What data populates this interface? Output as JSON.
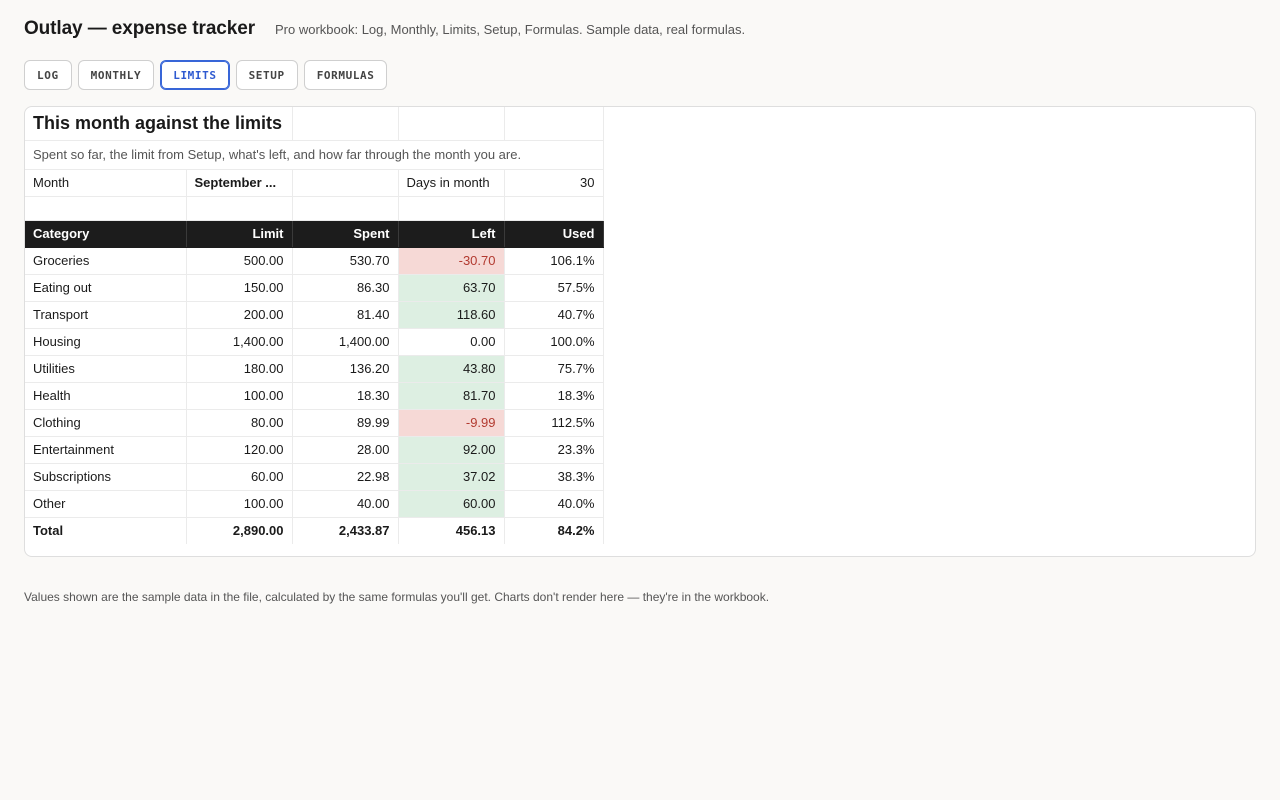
{
  "app": {
    "title": "Outlay — expense tracker",
    "subtitle": "Pro workbook: Log, Monthly, Limits, Setup, Formulas. Sample data, real formulas."
  },
  "tabs": [
    {
      "label": "LOG",
      "active": false
    },
    {
      "label": "MONTHLY",
      "active": false
    },
    {
      "label": "LIMITS",
      "active": true
    },
    {
      "label": "SETUP",
      "active": false
    },
    {
      "label": "FORMULAS",
      "active": false
    }
  ],
  "sheet": {
    "title": "This month against the limits",
    "description": "Spent so far, the limit from Setup, what's left, and how far through the month you are.",
    "month_label": "Month",
    "month_value": "September ...",
    "days_label": "Days in month",
    "days_value": "30",
    "headers": [
      "Category",
      "Limit",
      "Spent",
      "Left",
      "Used"
    ],
    "rows": [
      {
        "category": "Groceries",
        "limit": "500.00",
        "spent": "530.70",
        "left": "-30.70",
        "used": "106.1%",
        "status": "over"
      },
      {
        "category": "Eating out",
        "limit": "150.00",
        "spent": "86.30",
        "left": "63.70",
        "used": "57.5%",
        "status": "under"
      },
      {
        "category": "Transport",
        "limit": "200.00",
        "spent": "81.40",
        "left": "118.60",
        "used": "40.7%",
        "status": "under"
      },
      {
        "category": "Housing",
        "limit": "1,400.00",
        "spent": "1,400.00",
        "left": "0.00",
        "used": "100.0%",
        "status": "even"
      },
      {
        "category": "Utilities",
        "limit": "180.00",
        "spent": "136.20",
        "left": "43.80",
        "used": "75.7%",
        "status": "under"
      },
      {
        "category": "Health",
        "limit": "100.00",
        "spent": "18.30",
        "left": "81.70",
        "used": "18.3%",
        "status": "under"
      },
      {
        "category": "Clothing",
        "limit": "80.00",
        "spent": "89.99",
        "left": "-9.99",
        "used": "112.5%",
        "status": "over"
      },
      {
        "category": "Entertainment",
        "limit": "120.00",
        "spent": "28.00",
        "left": "92.00",
        "used": "23.3%",
        "status": "under"
      },
      {
        "category": "Subscriptions",
        "limit": "60.00",
        "spent": "22.98",
        "left": "37.02",
        "used": "38.3%",
        "status": "under"
      },
      {
        "category": "Other",
        "limit": "100.00",
        "spent": "40.00",
        "left": "60.00",
        "used": "40.0%",
        "status": "under"
      }
    ],
    "total": {
      "category": "Total",
      "limit": "2,890.00",
      "spent": "2,433.87",
      "left": "456.13",
      "used": "84.2%"
    }
  },
  "footer": {
    "note": "Values shown are the sample data in the file, calculated by the same formulas you'll get. Charts don't render here — they're in the workbook."
  },
  "colors": {
    "accent": "#3866d8",
    "header_bg": "#1c1c1c",
    "positive_bg": "#ddefe2",
    "negative_bg": "#f6d9d6",
    "negative_text": "#b23a30"
  }
}
